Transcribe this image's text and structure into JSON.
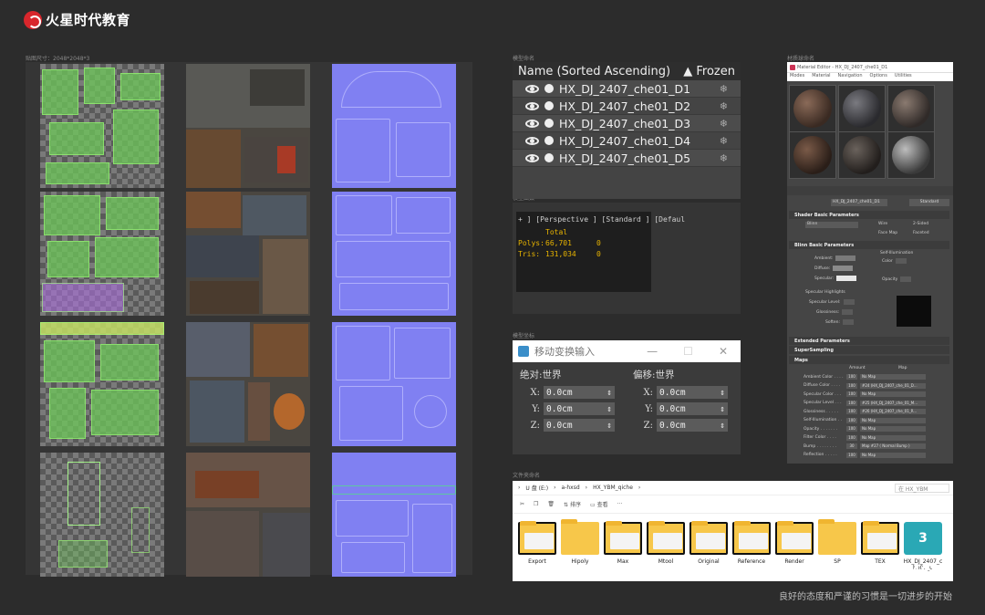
{
  "brand": {
    "name": "火星时代教育"
  },
  "sections": {
    "texture": "贴图尺寸：2048*2048*3",
    "scene": "模型命名",
    "stats": "模型面数",
    "xform": "模型坐标",
    "material": "材质球命名",
    "files": "文件夹命名"
  },
  "outliner": {
    "header_name": "Name (Sorted Ascending)",
    "header_frozen": "▲ Frozen",
    "items": [
      "HX_DJ_2407_che01_D1",
      "HX_DJ_2407_che01_D2",
      "HX_DJ_2407_che01_D3",
      "HX_DJ_2407_che01_D4",
      "HX_DJ_2407_che01_D5"
    ]
  },
  "stats": {
    "viewport": "+ ] [Perspective ] [Standard ] [Defaul",
    "total": "Total",
    "polys_label": "Polys:",
    "polys_value": "66,701",
    "polys_sel": "0",
    "tris_label": "Tris:",
    "tris_value": "131,034",
    "tris_sel": "0"
  },
  "xform": {
    "title": "移动变换输入",
    "absolute": "绝对:世界",
    "offset": "偏移:世界",
    "x": "X:",
    "y": "Y:",
    "z": "Z:",
    "value": "0.0cm"
  },
  "material": {
    "title": "Material Editor - HX_DJ_2407_che01_D1",
    "menu": [
      "Modes",
      "Material",
      "Navigation",
      "Options",
      "Utilities"
    ],
    "name_field": "HX_DJ_2407_che01_D1",
    "type_button": "Standard",
    "rollouts": [
      "Shader Basic Parameters",
      "Blinn Basic Parameters",
      "Extended Parameters",
      "SuperSampling",
      "Maps"
    ],
    "shader": "Blinn",
    "wire": "Wire",
    "two_sided": "2-Sided",
    "face_map": "Face Map",
    "faceted": "Faceted",
    "self_illum": "Self-Illumination",
    "color": "Color",
    "opacity": "Opacity",
    "ambient": "Ambient:",
    "diffuse": "Diffuse:",
    "specular": "Specular:",
    "spec_high": "Specular Highlights",
    "spec_level": "Specular Level:",
    "glossiness": "Glossiness:",
    "soften": "Soften:",
    "amount_h": "Amount",
    "map_h": "Map",
    "maps": [
      {
        "label": "Ambient Color . . . .",
        "amount": "100",
        "map": "No Map"
      },
      {
        "label": "Diffuse Color . . . .",
        "amount": "100",
        "map": "#24 (HX_DJ_2407_che_01_D..."
      },
      {
        "label": "Specular Color . . .",
        "amount": "100",
        "map": "No Map"
      },
      {
        "label": "Specular Level . . .",
        "amount": "100",
        "map": "#25 (HX_DJ_2407_che_01_M..."
      },
      {
        "label": "Glossiness . . . . .",
        "amount": "100",
        "map": "#26 (HX_DJ_2407_che_01_R..."
      },
      {
        "label": "Self-Illumination . .",
        "amount": "100",
        "map": "No Map"
      },
      {
        "label": "Opacity . . . . . . .",
        "amount": "100",
        "map": "No Map"
      },
      {
        "label": "Filter Color . . . .",
        "amount": "100",
        "map": "No Map"
      },
      {
        "label": "Bump . . . . . . . .",
        "amount": "30",
        "map": "Map #27 ( Normal Bump )"
      },
      {
        "label": "Reflection . . . . .",
        "amount": "100",
        "map": "No Map"
      }
    ]
  },
  "files": {
    "path": [
      "U 盘 (E:)",
      "a-hxsd",
      "HX_YBM_qiche"
    ],
    "search": "在 HX_YBM",
    "sort": "排序",
    "view": "查看",
    "more": "···",
    "items": [
      "Export",
      "Hipoly",
      "Max",
      "Mtool",
      "Original",
      "Reference",
      "Render",
      "SP",
      "TEX",
      "HX_DJ_2407_che01_0"
    ],
    "max_icon": "3 MAX"
  },
  "motto": "良好的态度和严谨的习惯是一切进步的开始",
  "colors": {
    "brand": "#d8262c",
    "bg": "#2c2c2c",
    "stats_yellow": "#e8b400",
    "normal_map": "#8080f2",
    "folder": "#f7c74a"
  }
}
